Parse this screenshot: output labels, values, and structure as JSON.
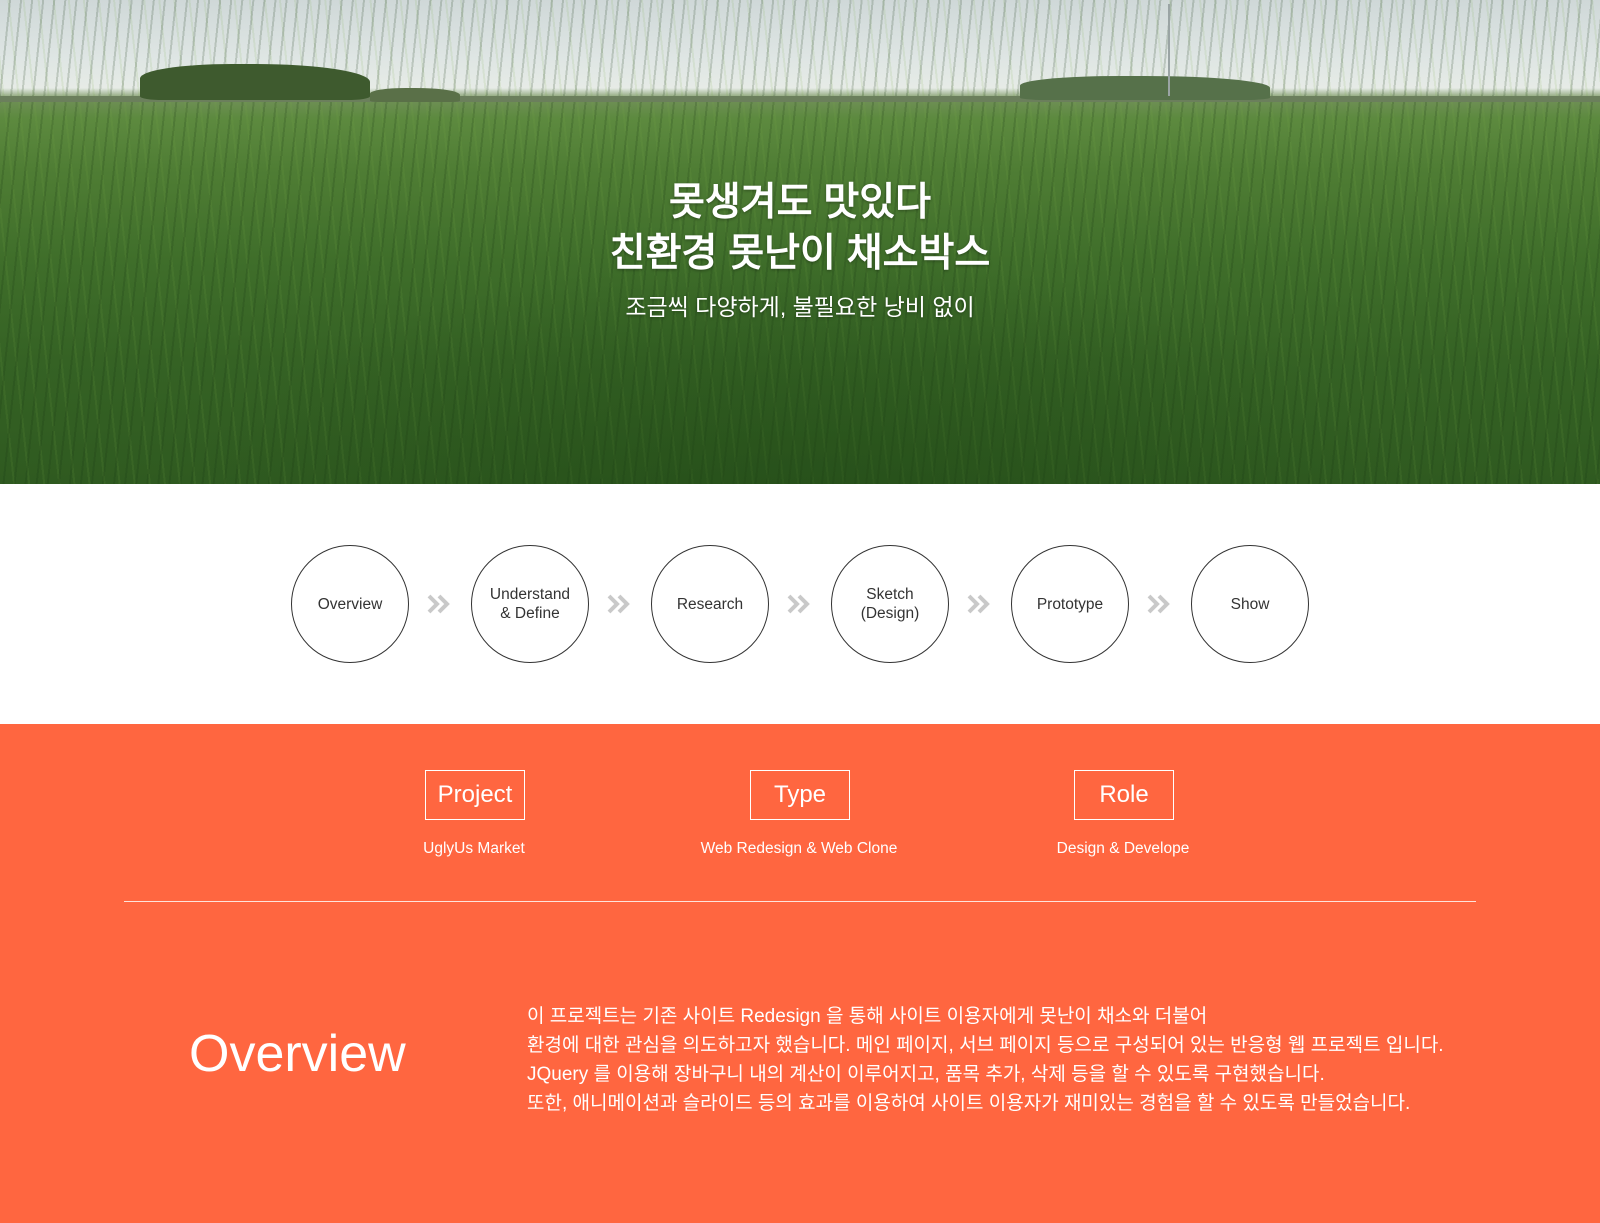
{
  "hero": {
    "title_line1": "못생겨도 맛있다",
    "title_line2": "친환경 못난이 채소박스",
    "subtitle": "조금씩 다양하게, 불필요한 낭비 없이"
  },
  "process": {
    "steps": [
      {
        "line1": "Overview",
        "line2": ""
      },
      {
        "line1": "Understand",
        "line2": "& Define"
      },
      {
        "line1": "Research",
        "line2": ""
      },
      {
        "line1": "Sketch",
        "line2": "(Design)"
      },
      {
        "line1": "Prototype",
        "line2": ""
      },
      {
        "line1": "Show",
        "line2": ""
      }
    ],
    "arrow_icon": "double-chevron-right-icon",
    "arrow_color": "#c9c9c9"
  },
  "info": {
    "background_color": "#ff6640",
    "meta": [
      {
        "label": "Project",
        "value": "UglyUs Market"
      },
      {
        "label": "Type",
        "value": "Web Redesign & Web Clone"
      },
      {
        "label": "Role",
        "value": "Design & Develope"
      }
    ],
    "overview": {
      "heading": "Overview",
      "lines": [
        "이 프로젝트는 기존 사이트 Redesign 을 통해 사이트 이용자에게 못난이 채소와 더불어",
        "환경에 대한 관심을 의도하고자 했습니다. 메인 페이지, 서브 페이지 등으로 구성되어 있는 반응형 웹 프로젝트 입니다.",
        "JQuery 를 이용해 장바구니 내의 계산이 이루어지고, 품목 추가, 삭제 등을 할 수 있도록 구현했습니다.",
        "또한, 애니메이션과 슬라이드 등의 효과를 이용하여 사이트 이용자가 재미있는 경험을 할 수 있도록 만들었습니다."
      ]
    }
  }
}
